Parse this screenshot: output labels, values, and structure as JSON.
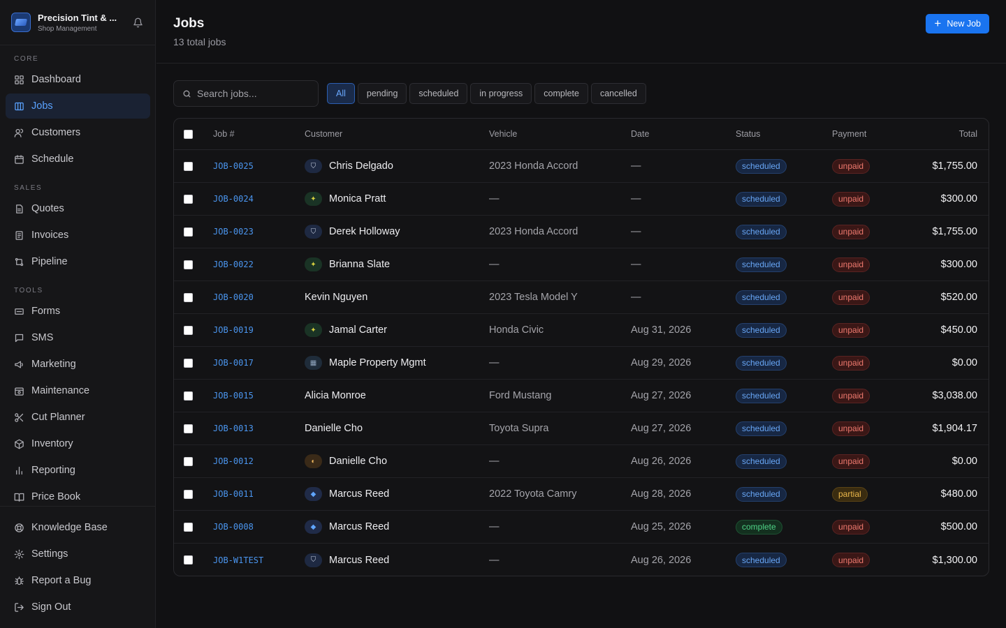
{
  "brand": {
    "name": "Precision Tint & ...",
    "subtitle": "Shop Management"
  },
  "sidebar": {
    "sections": {
      "core": "CORE",
      "sales": "SALES",
      "tools": "TOOLS"
    },
    "items": [
      {
        "label": "Dashboard",
        "icon": "dashboard-icon"
      },
      {
        "label": "Jobs",
        "icon": "jobs-icon"
      },
      {
        "label": "Customers",
        "icon": "customers-icon"
      },
      {
        "label": "Schedule",
        "icon": "calendar-icon"
      },
      {
        "label": "Quotes",
        "icon": "document-icon"
      },
      {
        "label": "Invoices",
        "icon": "invoice-icon"
      },
      {
        "label": "Pipeline",
        "icon": "pipeline-icon"
      },
      {
        "label": "Forms",
        "icon": "form-icon"
      },
      {
        "label": "SMS",
        "icon": "chat-icon"
      },
      {
        "label": "Marketing",
        "icon": "megaphone-icon"
      },
      {
        "label": "Maintenance",
        "icon": "maintenance-icon"
      },
      {
        "label": "Cut Planner",
        "icon": "scissors-icon"
      },
      {
        "label": "Inventory",
        "icon": "box-icon"
      },
      {
        "label": "Reporting",
        "icon": "bar-chart-icon"
      },
      {
        "label": "Price Book",
        "icon": "book-icon"
      }
    ],
    "footer": [
      {
        "label": "Knowledge Base",
        "icon": "lifebuoy-icon"
      },
      {
        "label": "Settings",
        "icon": "gear-icon"
      },
      {
        "label": "Report a Bug",
        "icon": "bug-icon"
      },
      {
        "label": "Sign Out",
        "icon": "sign-out-icon"
      }
    ]
  },
  "header": {
    "title": "Jobs",
    "subtitle": "13 total jobs",
    "new_button": "New Job"
  },
  "search": {
    "placeholder": "Search jobs..."
  },
  "filters": [
    "All",
    "pending",
    "scheduled",
    "in progress",
    "complete",
    "cancelled"
  ],
  "table": {
    "columns": {
      "job": "Job #",
      "customer": "Customer",
      "vehicle": "Vehicle",
      "date": "Date",
      "status": "Status",
      "payment": "Payment",
      "total": "Total"
    },
    "rows": [
      {
        "job": "JOB-0025",
        "avatar": "shield",
        "customer": "Chris Delgado",
        "vehicle": "2023 Honda Accord",
        "date": "—",
        "status": "scheduled",
        "payment": "unpaid",
        "total": "$1,755.00"
      },
      {
        "job": "JOB-0024",
        "avatar": "spark",
        "customer": "Monica Pratt",
        "vehicle": "—",
        "date": "—",
        "status": "scheduled",
        "payment": "unpaid",
        "total": "$300.00"
      },
      {
        "job": "JOB-0023",
        "avatar": "shield",
        "customer": "Derek Holloway",
        "vehicle": "2023 Honda Accord",
        "date": "—",
        "status": "scheduled",
        "payment": "unpaid",
        "total": "$1,755.00"
      },
      {
        "job": "JOB-0022",
        "avatar": "spark",
        "customer": "Brianna Slate",
        "vehicle": "—",
        "date": "—",
        "status": "scheduled",
        "payment": "unpaid",
        "total": "$300.00"
      },
      {
        "job": "JOB-0020",
        "avatar": "",
        "customer": "Kevin Nguyen",
        "vehicle": "2023 Tesla Model Y",
        "date": "—",
        "status": "scheduled",
        "payment": "unpaid",
        "total": "$520.00"
      },
      {
        "job": "JOB-0019",
        "avatar": "spark",
        "customer": "Jamal Carter",
        "vehicle": "Honda Civic",
        "date": "Aug 31, 2026",
        "status": "scheduled",
        "payment": "unpaid",
        "total": "$450.00"
      },
      {
        "job": "JOB-0017",
        "avatar": "building",
        "customer": "Maple Property Mgmt",
        "vehicle": "—",
        "date": "Aug 29, 2026",
        "status": "scheduled",
        "payment": "unpaid",
        "total": "$0.00"
      },
      {
        "job": "JOB-0015",
        "avatar": "",
        "customer": "Alicia Monroe",
        "vehicle": "Ford Mustang",
        "date": "Aug 27, 2026",
        "status": "scheduled",
        "payment": "unpaid",
        "total": "$3,038.00"
      },
      {
        "job": "JOB-0013",
        "avatar": "",
        "customer": "Danielle Cho",
        "vehicle": "Toyota Supra",
        "date": "Aug 27, 2026",
        "status": "scheduled",
        "payment": "unpaid",
        "total": "$1,904.17"
      },
      {
        "job": "JOB-0012",
        "avatar": "palette",
        "customer": "Danielle Cho",
        "vehicle": "—",
        "date": "Aug 26, 2026",
        "status": "scheduled",
        "payment": "unpaid",
        "total": "$0.00"
      },
      {
        "job": "JOB-0011",
        "avatar": "gem",
        "customer": "Marcus Reed",
        "vehicle": "2022 Toyota Camry",
        "date": "Aug 28, 2026",
        "status": "scheduled",
        "payment": "partial",
        "total": "$480.00"
      },
      {
        "job": "JOB-0008",
        "avatar": "gem",
        "customer": "Marcus Reed",
        "vehicle": "—",
        "date": "Aug 25, 2026",
        "status": "complete",
        "payment": "unpaid",
        "total": "$500.00"
      },
      {
        "job": "JOB-W1TEST",
        "avatar": "shield",
        "customer": "Marcus Reed",
        "vehicle": "—",
        "date": "Aug 26, 2026",
        "status": "scheduled",
        "payment": "unpaid",
        "total": "$1,300.00"
      }
    ]
  },
  "colors": {
    "accent": "#1a74f0",
    "scheduled": "#68a6f5",
    "complete": "#4fd487",
    "unpaid": "#f07a6f",
    "partial": "#ecb84b"
  }
}
